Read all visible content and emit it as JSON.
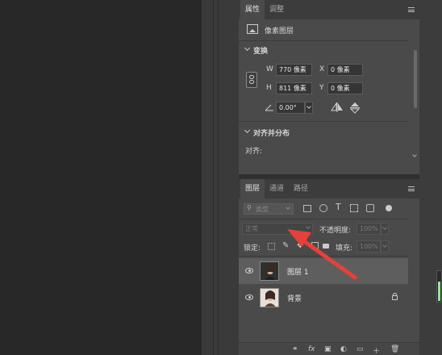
{
  "properties_panel": {
    "tabs": [
      "属性",
      "调整"
    ],
    "layer_kind": "像素图层",
    "transform": {
      "title": "变换",
      "w_label": "W",
      "w_value": "770 像素",
      "x_label": "X",
      "x_value": "0 像素",
      "h_label": "H",
      "h_value": "811 像素",
      "y_label": "Y",
      "y_value": "0 像素",
      "angle_value": "0.00°"
    },
    "align": {
      "title": "对齐并分布",
      "align_label": "对齐:"
    }
  },
  "layers_panel": {
    "tabs": [
      "图层",
      "通道",
      "路径"
    ],
    "filter_placeholder": "类型",
    "blend_mode": "正常",
    "opacity_label": "不透明度:",
    "opacity_value": "100%",
    "lock_label": "锁定:",
    "fill_label": "填充:",
    "fill_value": "100%",
    "layers": [
      {
        "name": "图层 1",
        "selected": true,
        "locked": false
      },
      {
        "name": "背景",
        "selected": false,
        "locked": true
      }
    ],
    "footer_icons": [
      "link-icon",
      "fx-icon",
      "mask-icon",
      "adjustment-icon",
      "group-icon",
      "new-layer-icon",
      "trash-icon"
    ],
    "footer_glyphs": [
      "⚭",
      "fx",
      "▣",
      "◐",
      "▭",
      "＋",
      "🗑"
    ]
  },
  "annotation_color": "#e5413a"
}
